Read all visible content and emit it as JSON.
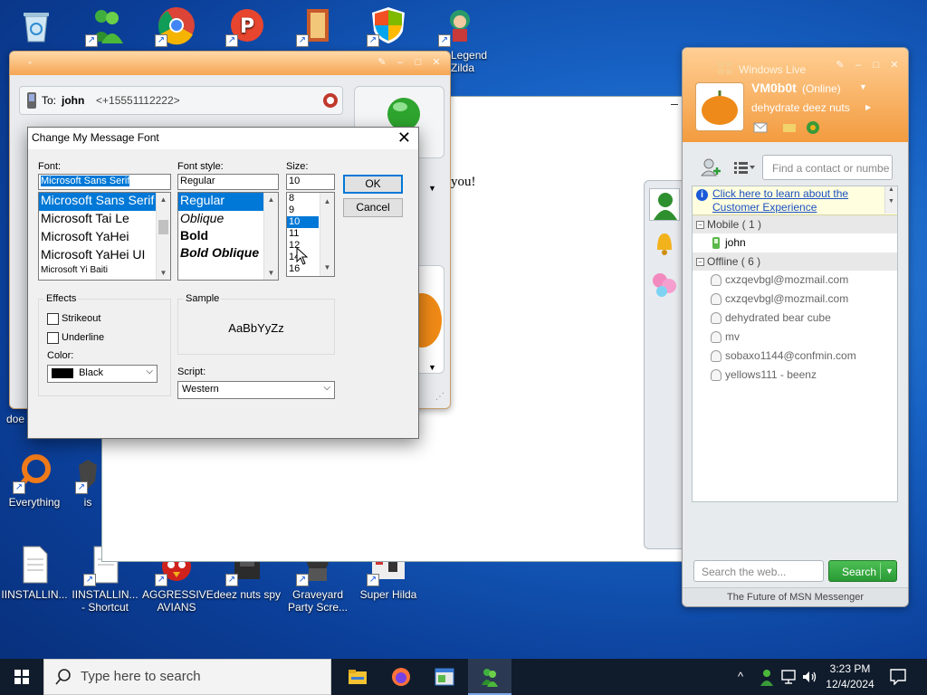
{
  "desktop_icons": [
    {
      "label": "",
      "icon": "recycle-bin-icon"
    },
    {
      "label": "",
      "icon": "messenger-icon"
    },
    {
      "label": "",
      "icon": "chrome-icon"
    },
    {
      "label": "",
      "icon": "p-app-icon"
    },
    {
      "label": "",
      "icon": "book-icon"
    },
    {
      "label": "",
      "icon": "windows-shield-icon"
    },
    {
      "label": "Legend Zilda",
      "icon": "zelda-icon"
    },
    {
      "label": "Everything",
      "icon": "everything-search-icon"
    },
    {
      "label": "is",
      "icon": "shield-app-icon"
    },
    {
      "label": "doe",
      "icon": "partial-icon"
    },
    {
      "label": "IINSTALLIN...",
      "icon": "document-icon"
    },
    {
      "label": "IINSTALLIN... - Shortcut",
      "icon": "document-shortcut-icon"
    },
    {
      "label": "AGGRESSIVE AVIANS",
      "icon": "angry-bird-icon"
    },
    {
      "label": "deez nuts spy",
      "icon": "spy-icon"
    },
    {
      "label": "Graveyard Party Scre...",
      "icon": "graveyard-icon"
    },
    {
      "label": "Super Hilda",
      "icon": "super-hilda-icon"
    }
  ],
  "conversation": {
    "to_prefix": "To:",
    "to_name": "john",
    "to_number": "<+15551112222>",
    "message_tail": "you!"
  },
  "font_dialog": {
    "title": "Change My Message Font",
    "font_label": "Font:",
    "font_value": "Microsoft Sans Serif",
    "fonts": [
      "Microsoft Sans Serif",
      "Microsoft Tai Le",
      "Microsoft YaHei",
      "Microsoft YaHei UI",
      "Microsoft Yi Baiti"
    ],
    "style_label": "Font style:",
    "style_value": "Regular",
    "styles": [
      "Regular",
      "Oblique",
      "Bold",
      "Bold Oblique"
    ],
    "size_label": "Size:",
    "size_value": "10",
    "sizes": [
      "8",
      "9",
      "10",
      "11",
      "12",
      "14",
      "16"
    ],
    "ok": "OK",
    "cancel": "Cancel",
    "effects_label": "Effects",
    "strikeout": "Strikeout",
    "underline": "Underline",
    "color_label": "Color:",
    "color_value": "Black",
    "sample_label": "Sample",
    "sample_text": "AaBbYyZz",
    "script_label": "Script:",
    "script_value": "Western"
  },
  "messenger": {
    "title": "Windows Live",
    "username": "VM0b0t",
    "status": "(Online)",
    "personal_message": "dehydrate deez nuts",
    "search_contact_placeholder": "Find a contact or numbe",
    "info_link": "Click here to learn about the Customer Experience",
    "groups": [
      {
        "label": "Mobile ( 1 )",
        "contacts": [
          "john"
        ]
      },
      {
        "label": "Offline ( 6 )",
        "contacts": [
          "cxzqevbgl@mozmail.com",
          "cxzqevbgl@mozmail.com",
          "dehydrated bear cube",
          "mv",
          "sobaxo1144@confmin.com",
          "yellows111 - beenz"
        ]
      }
    ],
    "web_search_placeholder": "Search the web...",
    "search_button": "Search",
    "footer": "The Future of MSN Messenger"
  },
  "taskbar": {
    "search_placeholder": "Type here to search",
    "time": "3:23 PM",
    "date": "12/4/2024"
  },
  "colors": {
    "accent_orange": "#f39b3f",
    "selection_blue": "#0078d7",
    "desktop_blue": "#1762c4",
    "search_green": "#2e9e3a"
  }
}
